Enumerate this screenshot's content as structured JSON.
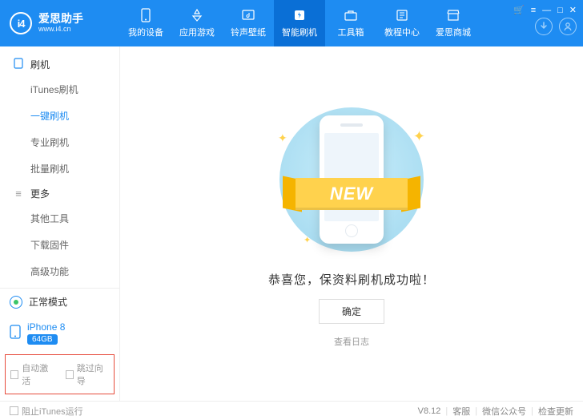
{
  "brand": {
    "name": "爱思助手",
    "url": "www.i4.cn",
    "logo_text": "i4"
  },
  "nav": [
    {
      "label": "我的设备",
      "icon": "phone"
    },
    {
      "label": "应用游戏",
      "icon": "apps"
    },
    {
      "label": "铃声壁纸",
      "icon": "music"
    },
    {
      "label": "智能刷机",
      "icon": "flash",
      "active": true
    },
    {
      "label": "工具箱",
      "icon": "toolbox"
    },
    {
      "label": "教程中心",
      "icon": "book"
    },
    {
      "label": "爱思商城",
      "icon": "store"
    }
  ],
  "sidebar": {
    "groups": [
      {
        "title": "刷机",
        "icon": "device",
        "items": [
          {
            "label": "iTunes刷机"
          },
          {
            "label": "一键刷机",
            "active": true
          },
          {
            "label": "专业刷机"
          },
          {
            "label": "批量刷机"
          }
        ]
      },
      {
        "title": "更多",
        "icon": "more",
        "items": [
          {
            "label": "其他工具"
          },
          {
            "label": "下载固件"
          },
          {
            "label": "高级功能"
          }
        ]
      }
    ],
    "mode_label": "正常模式",
    "device": {
      "name": "iPhone 8",
      "storage": "64GB"
    },
    "options": {
      "auto_activate": "自动激活",
      "skip_guide": "跳过向导"
    }
  },
  "main": {
    "ribbon_text": "NEW",
    "success_text": "恭喜您，保资料刷机成功啦！",
    "ok_label": "确定",
    "log_label": "查看日志"
  },
  "footer": {
    "block_itunes": "阻止iTunes运行",
    "version": "V8.12",
    "support": "客服",
    "wechat": "微信公众号",
    "update": "检查更新"
  }
}
